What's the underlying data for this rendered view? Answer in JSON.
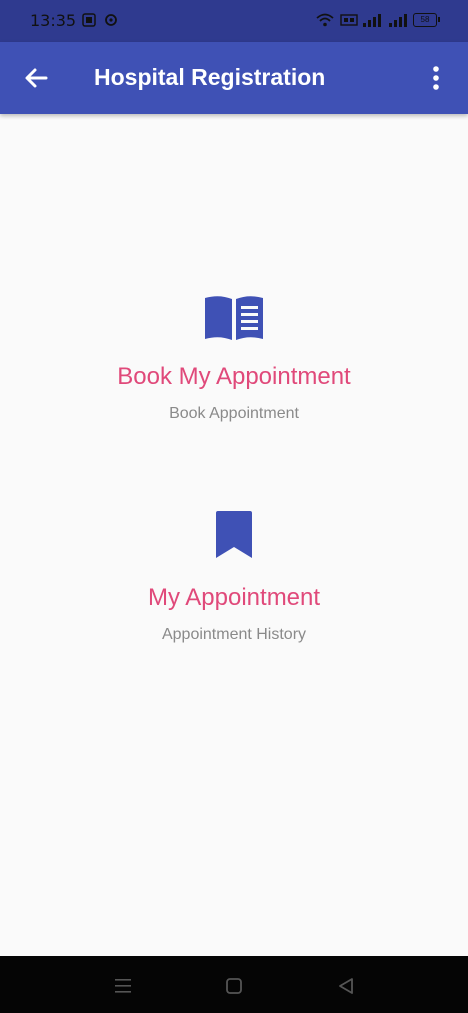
{
  "status_bar": {
    "time": "13:35",
    "battery": "58"
  },
  "app_bar": {
    "title": "Hospital Registration"
  },
  "menu": [
    {
      "icon": "open-book-icon",
      "title": "Book My Appointment",
      "subtitle": "Book Appointment"
    },
    {
      "icon": "bookmark-icon",
      "title": "My Appointment",
      "subtitle": "Appointment History"
    }
  ],
  "colors": {
    "status_bar": "#2f3a8f",
    "app_bar": "#3f51b5",
    "accent_pink": "#e0497a",
    "icon_blue": "#3f51b5",
    "subtitle_gray": "#8a8a8a",
    "background": "#fafafa"
  }
}
